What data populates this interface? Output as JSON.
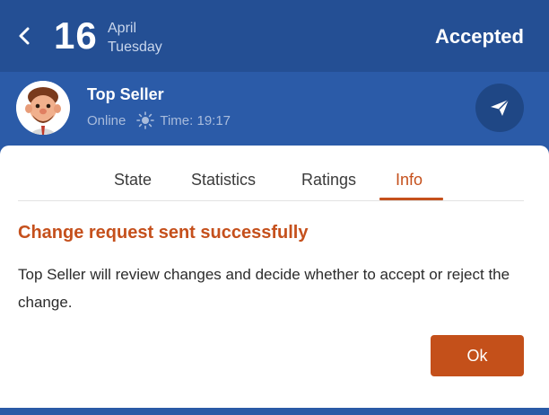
{
  "header": {
    "back_icon": "chevron-left-icon",
    "day": "16",
    "month": "April",
    "weekday": "Tuesday",
    "status": "Accepted"
  },
  "seller": {
    "name": "Top Seller",
    "online": "Online",
    "time_label": "Time: 19:17",
    "weather_icon": "sun-icon",
    "action_icon": "send-icon"
  },
  "tabs": [
    {
      "label": "State",
      "active": false
    },
    {
      "label": "Statistics",
      "active": false
    },
    {
      "label": "Ratings",
      "active": false
    },
    {
      "label": "Info",
      "active": true
    }
  ],
  "message": {
    "title": "Change request sent successfully",
    "body": "Top Seller will review changes and decide whether to accept or reject the change.",
    "ok_label": "Ok"
  },
  "colors": {
    "header_bg": "#244f94",
    "accent": "#c5501c",
    "background": "#2a5aa6"
  }
}
